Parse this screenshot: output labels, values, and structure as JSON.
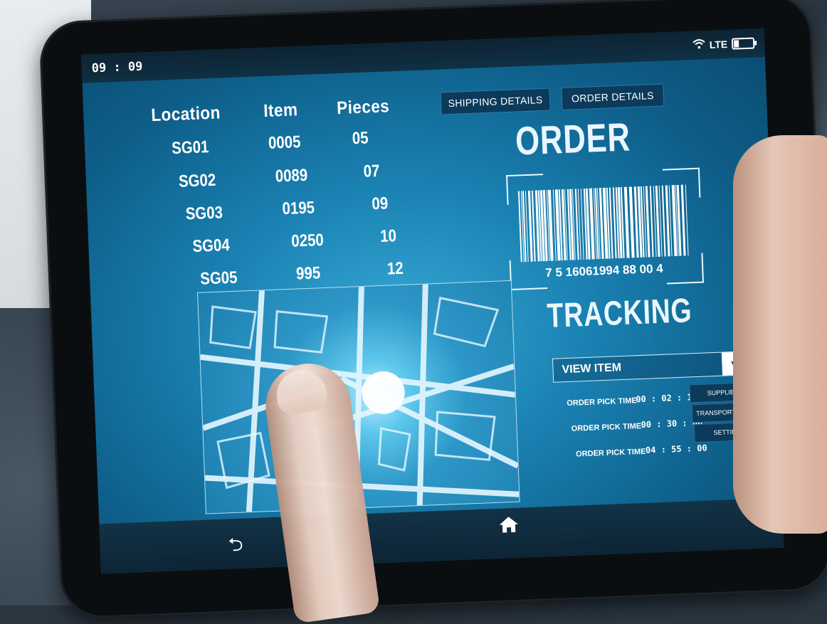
{
  "status": {
    "time": "09 : 09",
    "network": "LTE",
    "wifi_icon": "wifi-icon",
    "battery_icon": "battery-icon",
    "battery_level": 0.25
  },
  "table": {
    "headers": [
      "Location",
      "Item",
      "Pieces"
    ],
    "rows": [
      [
        "SG01",
        "0005",
        "05"
      ],
      [
        "SG02",
        "0089",
        "07"
      ],
      [
        "SG03",
        "0195",
        "09"
      ],
      [
        "SG04",
        "0250",
        "10"
      ],
      [
        "SG05",
        "995",
        "12"
      ]
    ]
  },
  "tabs": {
    "shipping": "SHIPPING DETAILS",
    "order": "ORDER DETAILS"
  },
  "order_title": "ORDER",
  "barcode": {
    "number": "7 5 16061994 88 00 4"
  },
  "tracking_title": "TRACKING",
  "view_select": {
    "label": "VIEW ITEM",
    "arrow_icon": "triangle-down-icon"
  },
  "pick_times": [
    {
      "label": "ORDER PICK TIME",
      "time": "00 : 02 : 15"
    },
    {
      "label": "ORDER PICK TIME",
      "time": "00 : 30 : 00"
    },
    {
      "label": "ORDER PICK TIME",
      "time": "04 : 55 : 00"
    }
  ],
  "side_buttons": [
    "SUPPLIER",
    "TRANSPORTATION",
    "SETTING"
  ],
  "nav": {
    "back_icon": "back-arrow-icon",
    "home_icon": "home-icon",
    "menu_icon": "hamburger-menu-icon"
  },
  "colors": {
    "screen": "#1a82b3",
    "button_bg": "#0c3a5a",
    "text": "#ffffff"
  }
}
